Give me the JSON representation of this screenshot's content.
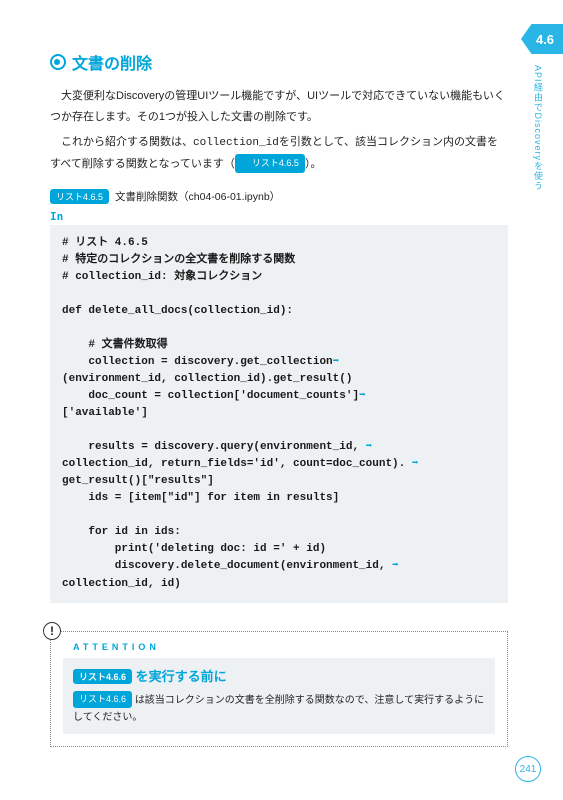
{
  "corner": "4.6",
  "sideLabel": "API経由でDiscoveryを使う",
  "sectionTitle": "文書の削除",
  "para1": "大変便利なDiscoveryの管理UIツール機能ですが、UIツールで対応できていない機能もいくつか存在します。その1つが投入した文書の削除です。",
  "para2a": "これから紹介する関数は、",
  "para2code": "collection_id",
  "para2b": "を引数として、該当コレクション内の文書をすべて削除する関数となっています（",
  "para2badge": "リスト4.6.5",
  "para2c": "）。",
  "listingBadge": "リスト4.6.5",
  "listingCaption": "文書削除関数（ch04-06-01.ipynb）",
  "inLabel": "In",
  "code": {
    "l1": "# リスト 4.6.5",
    "l2": "# 特定のコレクションの全文書を削除する関数",
    "l3": "# collection_id: 対象コレクション",
    "l4": "",
    "l5": "def delete_all_docs(collection_id):",
    "l6": "",
    "l7": "    # 文書件数取得",
    "l8a": "    collection = discovery.get_collection",
    "l9": "(environment_id, collection_id).get_result()",
    "l10a": "    doc_count = collection['document_counts']",
    "l11": "['available']",
    "l12": "",
    "l13a": "    results = discovery.query(environment_id, ",
    "l14a": "collection_id, return_fields='id', count=doc_count). ",
    "l15": "get_result()[\"results\"]",
    "l16": "    ids = [item[\"id\"] for item in results]",
    "l17": "",
    "l18": "    for id in ids:",
    "l19": "        print('deleting doc: id =' + id)",
    "l20a": "        discovery.delete_document(environment_id, ",
    "l21": "collection_id, id)"
  },
  "arrow": "➡",
  "attention": {
    "label": "ATTENTION",
    "titleBadge": "リスト4.6.6",
    "titleText": "を実行する前に",
    "bodyBadge": "リスト4.6.6",
    "bodyText": "は該当コレクションの文書を全削除する関数なので、注意して実行するようにしてください。"
  },
  "pageNum": "241"
}
